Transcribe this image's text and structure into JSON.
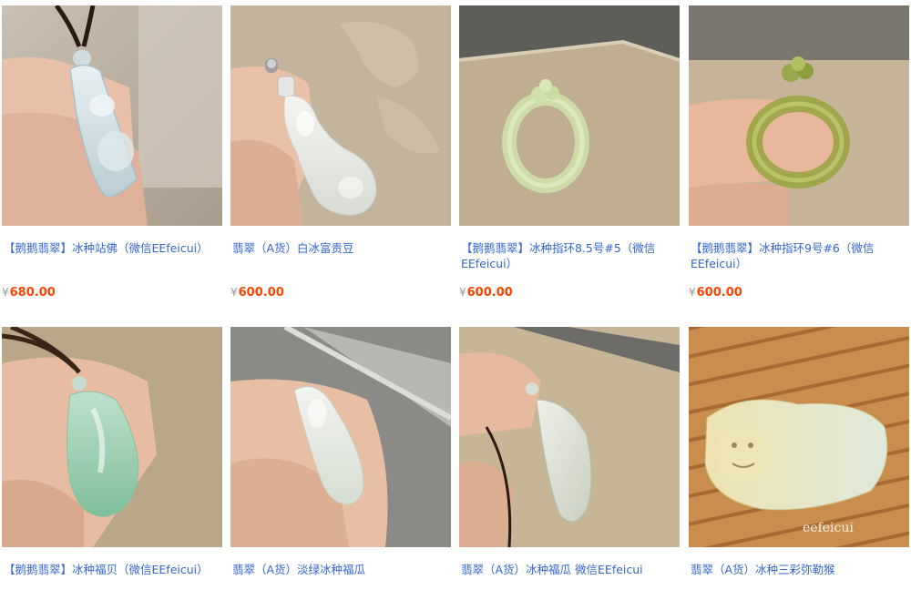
{
  "products": [
    {
      "title": "【鹅鹅翡翠】冰种站佛（微信EEfeicui）",
      "currency": "¥",
      "price": "680.00",
      "icon": "jade-buddha-pendant-photo"
    },
    {
      "title": "翡翠（A货）白冰富贵豆",
      "currency": "¥",
      "price": "600.00",
      "icon": "jade-peapod-pendant-photo"
    },
    {
      "title": "【鹅鹅翡翠】冰种指环8.5号#5（微信EEfeicui）",
      "currency": "¥",
      "price": "600.00",
      "icon": "jade-ring-photo"
    },
    {
      "title": "【鹅鹅翡翠】冰种指环9号#6（微信EEfeicui）",
      "currency": "¥",
      "price": "600.00",
      "icon": "jade-ring-on-finger-photo"
    },
    {
      "title": "【鹅鹅翡翠】冰种福贝（微信EEfeicui）",
      "icon": "jade-shell-pendant-photo"
    },
    {
      "title": "翡翠（A货）淡绿冰种福瓜",
      "icon": "jade-gourd-pendant-photo"
    },
    {
      "title": "翡翠（A货）冰种福瓜 微信EEfeicui",
      "icon": "jade-gourd-side-photo"
    },
    {
      "title": "翡翠（A货）冰种三彩弥勒猴",
      "icon": "jade-monkey-carving-photo",
      "watermark": "eefeicui"
    }
  ]
}
